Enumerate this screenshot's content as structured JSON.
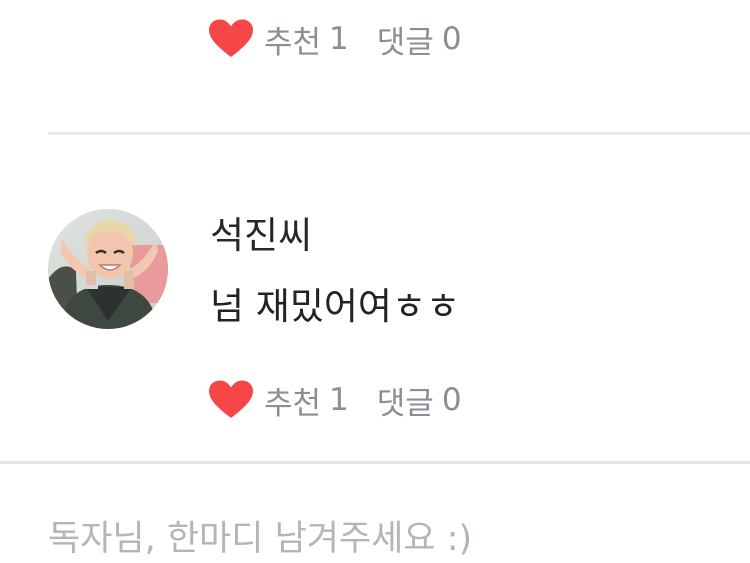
{
  "previous_comment": {
    "actions": {
      "like_label": "추천",
      "like_count": "1",
      "reply_label": "댓글",
      "reply_count": "0"
    }
  },
  "comment": {
    "author": "석진씨",
    "text": "넘 재밌어여ㅎㅎ",
    "actions": {
      "like_label": "추천",
      "like_count": "1",
      "reply_label": "댓글",
      "reply_count": "0"
    }
  },
  "input": {
    "placeholder": "독자님, 한마디 남겨주세요 :)"
  },
  "colors": {
    "heart": "#f54747",
    "action_text": "#8a8f95",
    "divider": "#e6e9e9",
    "placeholder": "#b2b6b8"
  },
  "icons": {
    "like": "heart-icon"
  }
}
